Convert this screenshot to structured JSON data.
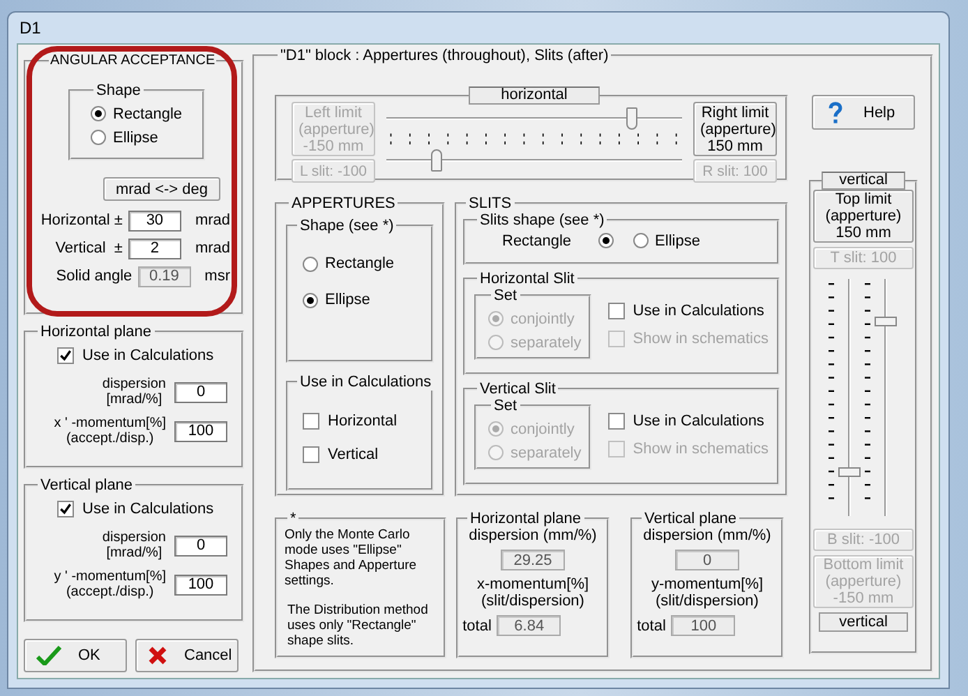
{
  "window": {
    "title": "D1"
  },
  "angular_acceptance": {
    "title": "ANGULAR ACCEPTANCE",
    "shape": {
      "title": "Shape",
      "options": [
        {
          "label": "Rectangle",
          "selected": true
        },
        {
          "label": "Ellipse",
          "selected": false
        }
      ]
    },
    "convert_button": "mrad <-> deg",
    "fields": [
      {
        "label": "Horizontal ±",
        "value": "30",
        "unit": "mrad",
        "disabled": false
      },
      {
        "label": "Vertical  ±",
        "value": "2",
        "unit": "mrad",
        "disabled": false
      },
      {
        "label": "Solid angle",
        "value": "0.19",
        "unit": "msr",
        "disabled": true
      }
    ]
  },
  "planes": [
    {
      "title": "Horizontal plane",
      "use": {
        "label": "Use in Calculations",
        "checked": true
      },
      "fields": [
        {
          "label": "dispersion\n[mrad/%]",
          "value": "0"
        },
        {
          "label": "x ' -momentum[%]\n(accept./disp.)",
          "value": "100"
        }
      ]
    },
    {
      "title": "Vertical plane",
      "use": {
        "label": "Use in Calculations",
        "checked": true
      },
      "fields": [
        {
          "label": "dispersion\n[mrad/%]",
          "value": "0"
        },
        {
          "label": "y ' -momentum[%]\n(accept./disp.)",
          "value": "100"
        }
      ]
    }
  ],
  "buttons": [
    {
      "label": "OK",
      "kind": "ok"
    },
    {
      "label": "Cancel",
      "kind": "cancel"
    }
  ],
  "block": {
    "title": "\"D1\" block : Appertures (throughout), Slits (after)",
    "horizontal": {
      "label": "horizontal",
      "limits": [
        {
          "label": "Left limit\n(apperture)\n-150 mm",
          "disabled": true
        },
        {
          "label": "Right limit\n(apperture)\n150 mm",
          "disabled": false
        }
      ],
      "slits": [
        {
          "label": "L slit: -100",
          "disabled": true
        },
        {
          "label": "R slit: 100",
          "disabled": true
        }
      ],
      "aperture_slider": {
        "level": 0.83
      },
      "slit_slider": {
        "level": 0.17
      }
    },
    "help_button": "Help",
    "appertures": {
      "title": "APPERTURES",
      "shape": {
        "title": "Shape (see *)",
        "options": [
          {
            "label": "Rectangle",
            "selected": false
          },
          {
            "label": "Ellipse",
            "selected": true
          }
        ]
      },
      "use": {
        "title": "Use in Calculations",
        "options": [
          {
            "label": "Horizontal",
            "checked": false
          },
          {
            "label": "Vertical",
            "checked": false
          }
        ]
      }
    },
    "slits": {
      "title": "SLITS",
      "shape": {
        "title": "Slits shape (see *)",
        "options": [
          {
            "label": "Rectangle",
            "selected": true,
            "kind": "leading"
          },
          {
            "label": "Ellipse",
            "selected": false,
            "kind": "trailing"
          }
        ]
      },
      "groups": [
        {
          "title": "Horizontal Slit",
          "set": {
            "title": "Set",
            "disabled": true,
            "options": [
              {
                "label": "conjointly",
                "selected": true
              },
              {
                "label": "separately",
                "selected": false
              }
            ]
          },
          "checks": [
            {
              "label": "Use in Calculations",
              "checked": false,
              "disabled": false
            },
            {
              "label": "Show in schematics",
              "checked": false,
              "disabled": true
            }
          ]
        },
        {
          "title": "Vertical Slit",
          "set": {
            "title": "Set",
            "disabled": true,
            "options": [
              {
                "label": "conjointly",
                "selected": true
              },
              {
                "label": "separately",
                "selected": false
              }
            ]
          },
          "checks": [
            {
              "label": "Use in Calculations",
              "checked": false,
              "disabled": false
            },
            {
              "label": "Show in schematics",
              "checked": false,
              "disabled": true
            }
          ]
        }
      ]
    },
    "note": {
      "title": "*",
      "paragraphs": [
        "Only the Monte Carlo mode uses \"Ellipse\" Shapes and Apperture settings.",
        "The Distribution method uses only  \"Rectangle\" shape slits."
      ]
    },
    "plane_results": [
      {
        "title": "Horizontal plane",
        "dispersion_label": "dispersion (mm/%)",
        "dispersion": "29.25",
        "momentum_label": "x-momentum[%]\n(slit/dispersion)",
        "total_label": "total",
        "total": "6.84"
      },
      {
        "title": "Vertical plane",
        "dispersion_label": "dispersion (mm/%)",
        "dispersion": "0",
        "momentum_label": "y-momentum[%]\n(slit/dispersion)",
        "total_label": "total",
        "total": "100"
      }
    ],
    "vertical": {
      "label": "vertical",
      "top_limit": {
        "label": "Top limit\n(apperture)\n150 mm",
        "disabled": false
      },
      "top_slit": {
        "label": "T slit: 100",
        "disabled": true
      },
      "sliders": [
        {
          "level": 0.18
        },
        {
          "level": 0.82
        }
      ],
      "bottom_slit": {
        "label": "B slit: -100",
        "disabled": true
      },
      "bottom_limit": {
        "label": "Bottom limit\n(apperture)\n-150 mm",
        "disabled": true
      },
      "bottom_label": "vertical"
    }
  }
}
